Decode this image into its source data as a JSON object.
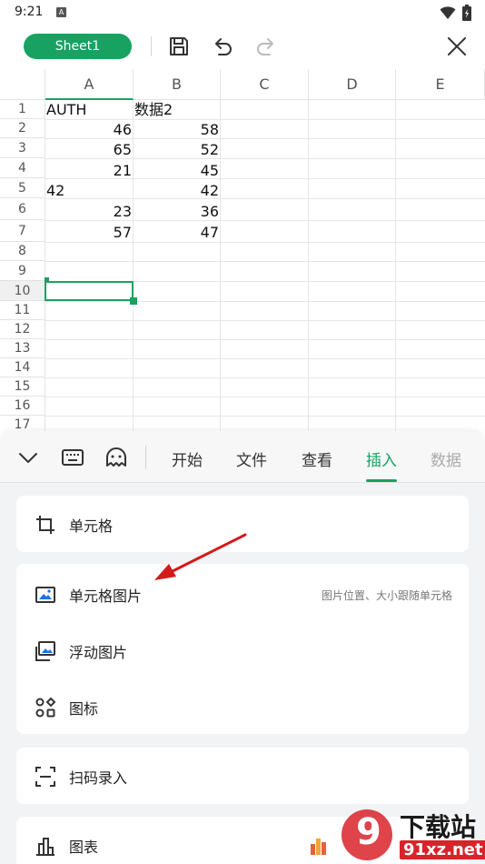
{
  "status": {
    "time": "9:21",
    "notif": "A"
  },
  "toolbar": {
    "sheet_name": "Sheet1"
  },
  "grid": {
    "columns": [
      "A",
      "B",
      "C",
      "D",
      "E"
    ],
    "rows": [
      "1",
      "2",
      "3",
      "4",
      "5",
      "6",
      "7",
      "8",
      "9",
      "10",
      "11",
      "12",
      "13",
      "14",
      "15",
      "16",
      "17"
    ],
    "cells": {
      "r1": {
        "a": "AUTH",
        "b": "数据2"
      },
      "r2": {
        "a": "46",
        "b": "58"
      },
      "r3": {
        "a": "65",
        "b": "52"
      },
      "r4": {
        "a": "21",
        "b": "45"
      },
      "r5": {
        "a": "42",
        "b": "42"
      },
      "r6": {
        "a": "23",
        "b": "36"
      },
      "r7": {
        "a": "57",
        "b": "47"
      }
    }
  },
  "panel": {
    "tabs": [
      "开始",
      "文件",
      "查看",
      "插入",
      "数据"
    ],
    "active_tab": "插入",
    "items": {
      "cell": "单元格",
      "cell_image": "单元格图片",
      "cell_image_hint": "图片位置、大小跟随单元格",
      "float_image": "浮动图片",
      "icon": "图标",
      "scan": "扫码录入",
      "chart": "图表"
    }
  },
  "watermark": {
    "text": "下载站",
    "url_text": "91xz.net",
    "logo_text": "9"
  },
  "colors": {
    "accent": "#17a262",
    "arrow": "#d41a1a"
  }
}
